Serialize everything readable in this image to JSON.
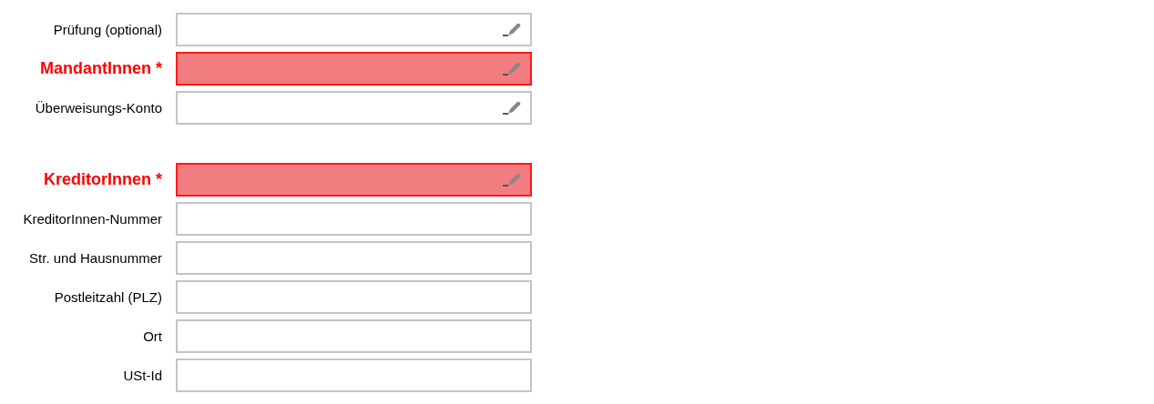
{
  "sections": [
    {
      "fields": [
        {
          "label": "Prüfung (optional)",
          "kind": "lookup",
          "required": false,
          "invalid": false
        },
        {
          "label": "MandantInnen *",
          "kind": "lookup",
          "required": true,
          "invalid": true
        },
        {
          "label": "Überweisungs-Konto",
          "kind": "lookup",
          "required": false,
          "invalid": false
        }
      ]
    },
    {
      "fields": [
        {
          "label": "KreditorInnen *",
          "kind": "lookup",
          "required": true,
          "invalid": true
        },
        {
          "label": "KreditorInnen-Nummer",
          "kind": "text",
          "required": false,
          "invalid": false
        },
        {
          "label": "Str. und Hausnummer",
          "kind": "text",
          "required": false,
          "invalid": false
        },
        {
          "label": "Postleitzahl (PLZ)",
          "kind": "text",
          "required": false,
          "invalid": false
        },
        {
          "label": "Ort",
          "kind": "text",
          "required": false,
          "invalid": false
        },
        {
          "label": "USt-Id",
          "kind": "text",
          "required": false,
          "invalid": false
        }
      ]
    }
  ]
}
